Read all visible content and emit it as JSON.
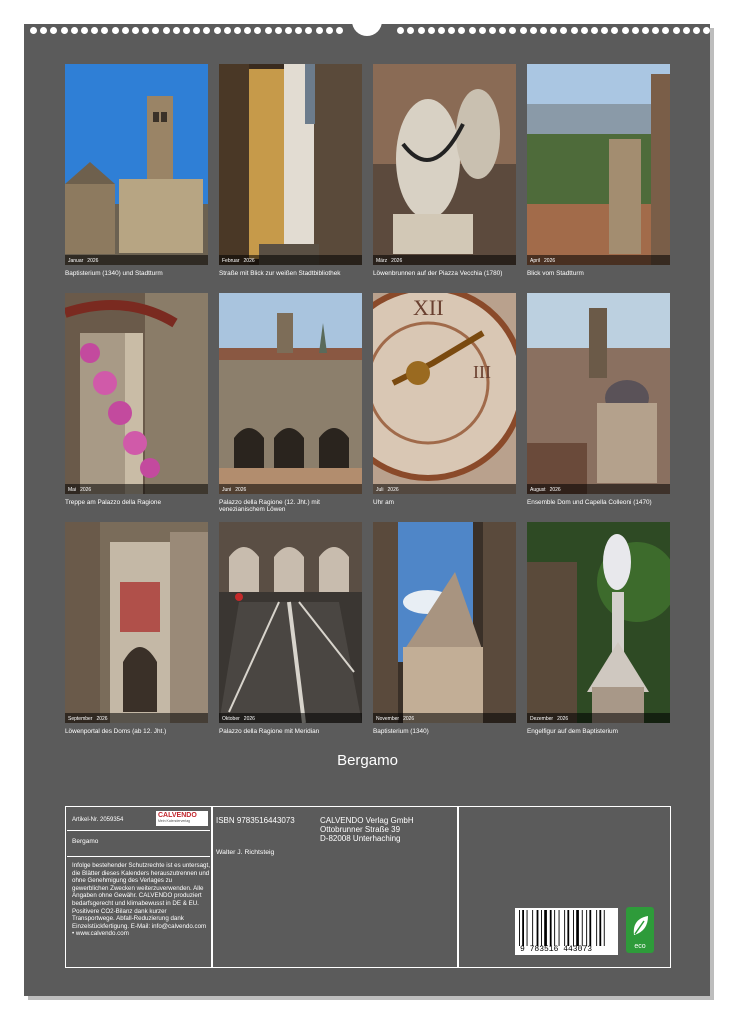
{
  "title": "Bergamo",
  "months": [
    {
      "month": "Januar",
      "year": "2026",
      "caption": "Baptisterium (1340) und Stadtturm"
    },
    {
      "month": "Februar",
      "year": "2026",
      "caption": "Straße mit Blick zur weißen Stadtbibliothek"
    },
    {
      "month": "März",
      "year": "2026",
      "caption": "Löwenbrunnen auf der Piazza Vecchia (1780)"
    },
    {
      "month": "April",
      "year": "2026",
      "caption": "Blick vom Stadtturm"
    },
    {
      "month": "Mai",
      "year": "2026",
      "caption": "Treppe am Palazzo della Ragione"
    },
    {
      "month": "Juni",
      "year": "2026",
      "caption": "Palazzo della Ragione (12. Jht.) mit venezianischem Löwen"
    },
    {
      "month": "Juli",
      "year": "2026",
      "caption": "Uhr am"
    },
    {
      "month": "August",
      "year": "2026",
      "caption": "Ensemble Dom und Capella Colleoni (1470)"
    },
    {
      "month": "September",
      "year": "2026",
      "caption": "Löwenportal des Doms (ab 12. Jht.)"
    },
    {
      "month": "Oktober",
      "year": "2026",
      "caption": "Palazzo della Ragione mit Meridian"
    },
    {
      "month": "November",
      "year": "2026",
      "caption": "Baptisterium (1340)"
    },
    {
      "month": "Dezember",
      "year": "2026",
      "caption": "Engelfigur auf dem Baptisterium"
    }
  ],
  "info": {
    "article_no": "Artikel-Nr.  2059354",
    "logo_text": "CALVENDO",
    "logo_sub": "Mein Kalenderverlag",
    "product_title": "Bergamo",
    "legal_text": "Infolge bestehender Schutzrechte ist es untersagt, die Blätter dieses Kalenders herauszutrennen und ohne Genehmigung des Verlages zu gewerblichen Zwecken weiterzuverwenden. Alle Angaben ohne Gewähr. CALVENDO produziert bedarfsgerecht und klimabewusst in DE & EU. Positivere CO2-Bilanz dank kurzer Transportwege. Abfall-Reduzierung dank Einzelstückfertigung. E-Mail: info@calvendo.com • www.calvendo.com",
    "isbn": "ISBN 9783516443073",
    "author": "Walter J. Richtsteig",
    "publisher_name": "CALVENDO Verlag GmbH",
    "publisher_street": "Ottobrunner Straße 39",
    "publisher_city": "D-82008 Unterhaching",
    "barcode_digits": "9 783516 443073",
    "eco_label": "eco"
  }
}
